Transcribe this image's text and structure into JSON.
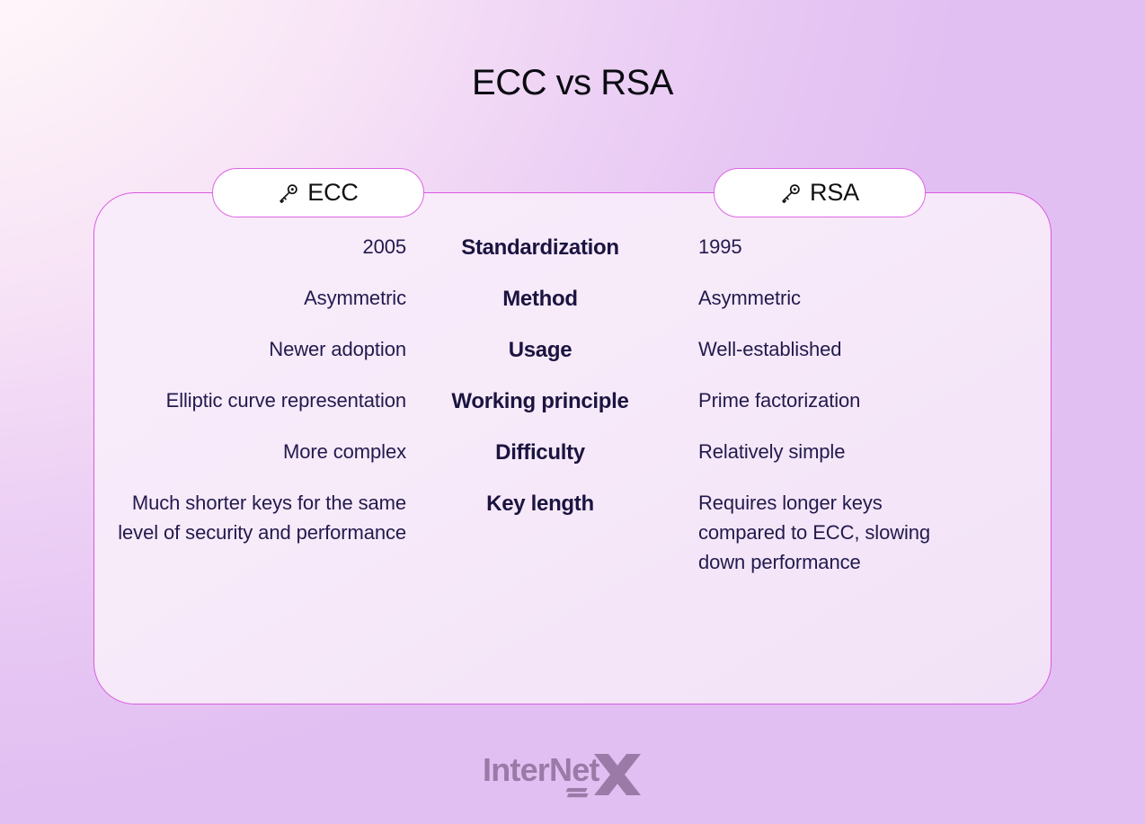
{
  "title": "ECC vs RSA",
  "columns": {
    "left": {
      "label": "ECC",
      "icon": "key-icon"
    },
    "right": {
      "label": "RSA",
      "icon": "key-icon"
    }
  },
  "rows": [
    {
      "attribute": "Standardization",
      "ecc": "2005",
      "rsa": "1995"
    },
    {
      "attribute": "Method",
      "ecc": "Asymmetric",
      "rsa": "Asymmetric"
    },
    {
      "attribute": "Usage",
      "ecc": "Newer adoption",
      "rsa": "Well-established"
    },
    {
      "attribute": "Working principle",
      "ecc": "Elliptic curve representation",
      "rsa": "Prime factorization"
    },
    {
      "attribute": "Difficulty",
      "ecc": "More complex",
      "rsa": "Relatively simple"
    },
    {
      "attribute": "Key length",
      "ecc": "Much shorter keys for the same level of security and performance",
      "rsa": "Requires longer keys compared to ECC, slowing down performance"
    }
  ],
  "footer": {
    "brand": "InterNet",
    "brand_mark": "X"
  },
  "colors": {
    "accent_border": "#d95ae0",
    "title_text": "#0b0b12",
    "body_text": "#221a4d",
    "attribute_text": "#1b1440",
    "card_bg": "#f6e9f9",
    "pill_bg": "#ffffff",
    "logo": "#9b7aa8"
  }
}
